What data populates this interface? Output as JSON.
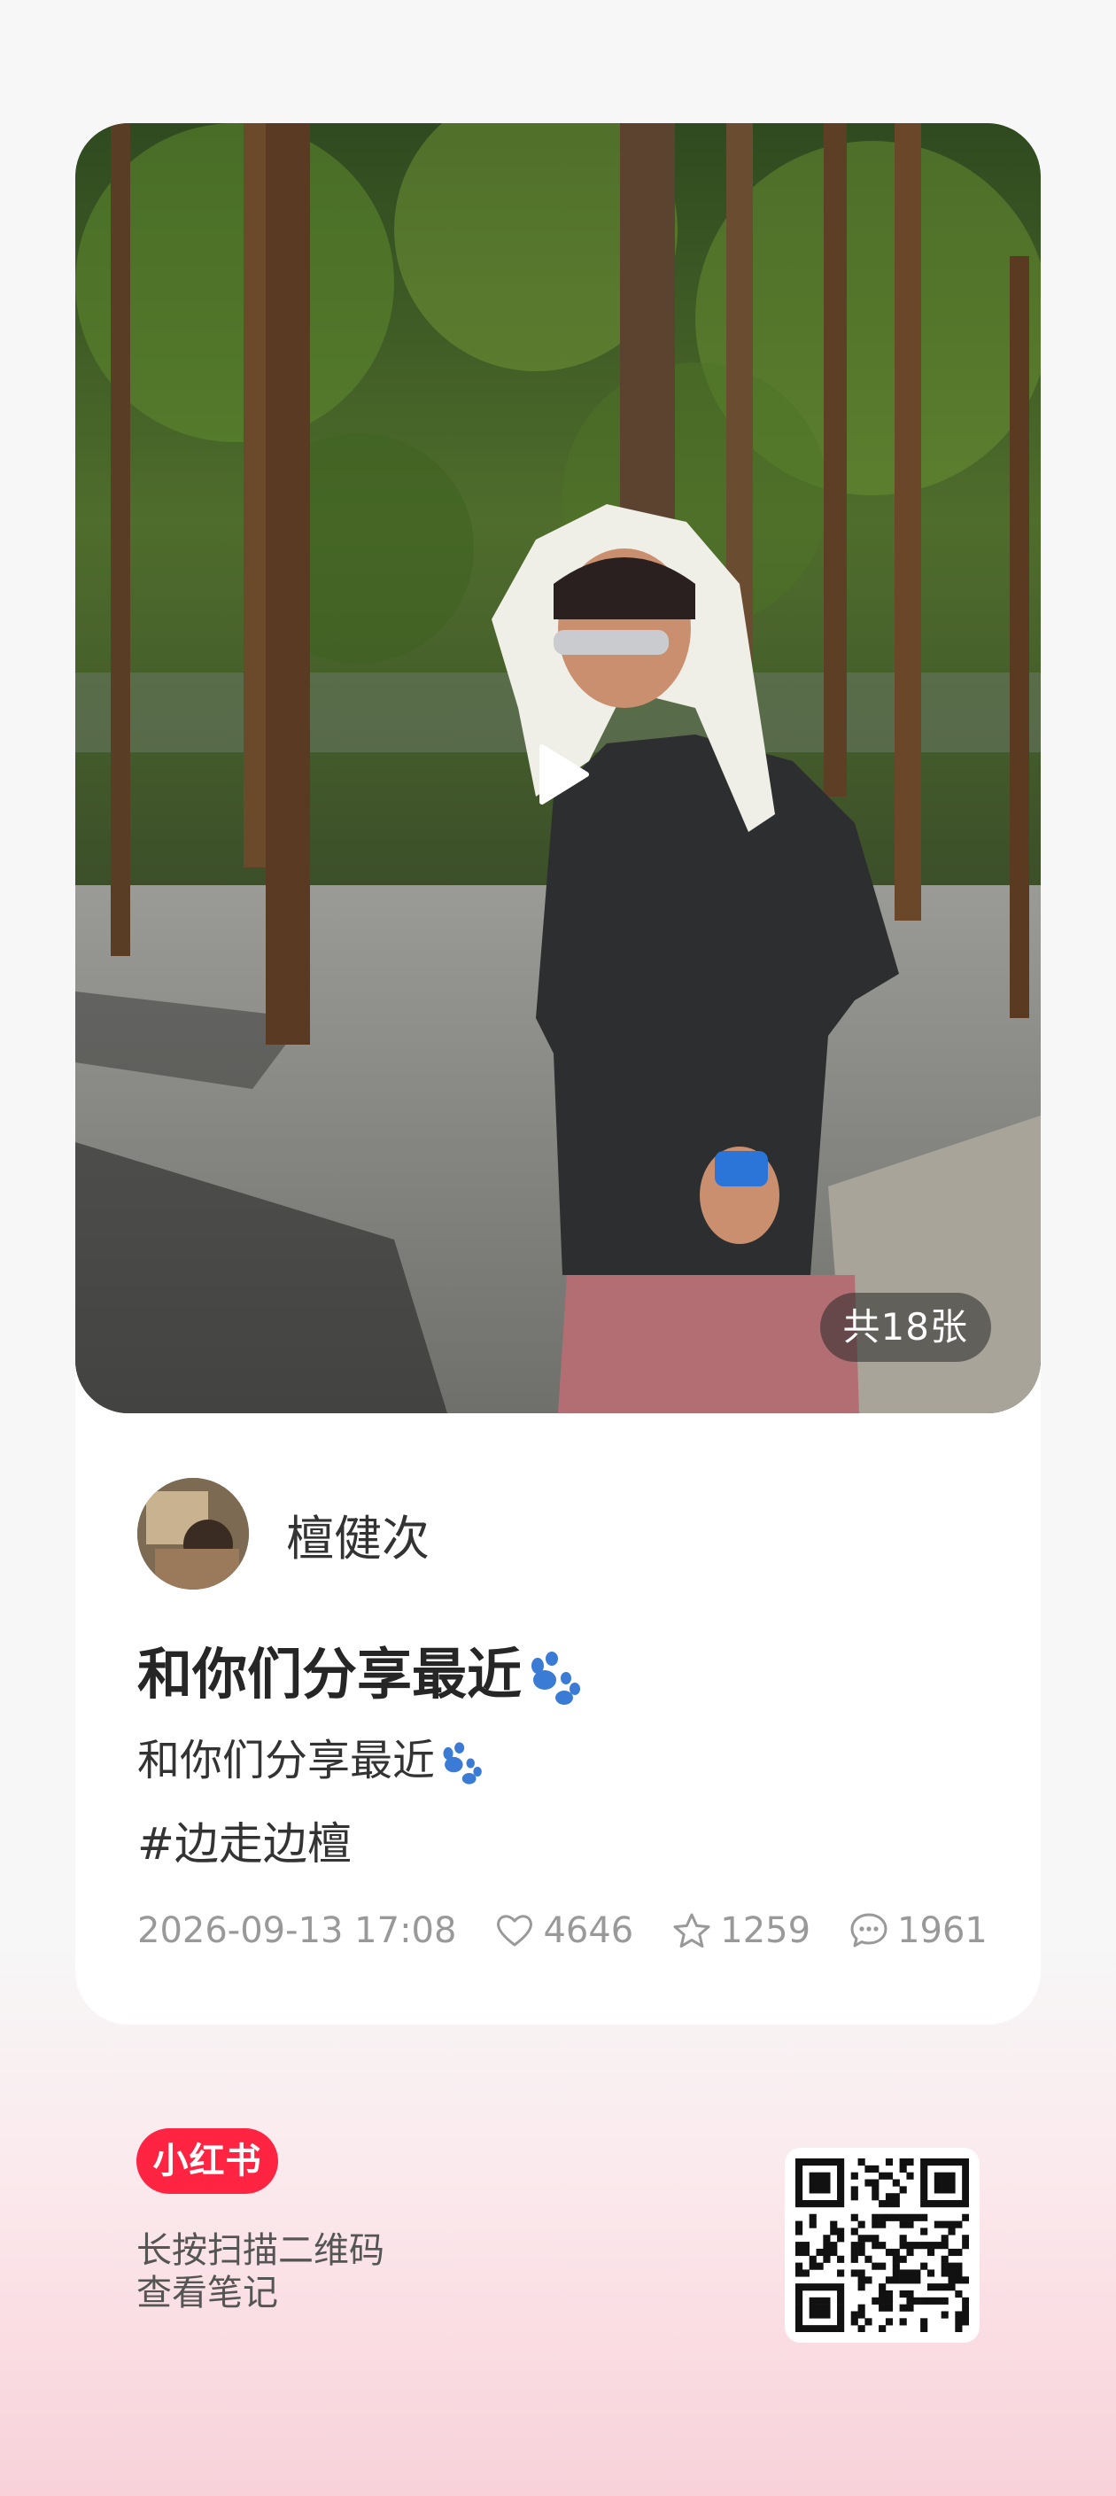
{
  "post": {
    "image_count_label": "共18张",
    "author_name": "檀健次",
    "title": "和你们分享最近",
    "body": "和你们分享最近",
    "hashtag": "#边走边檀",
    "date": "2026-09-13 17:08",
    "likes": "4646",
    "favorites": "1259",
    "comments": "1961"
  },
  "footer": {
    "brand": "小红书",
    "scan_tip_line1": "长按扫描二维码",
    "scan_tip_line2": "查看笔记"
  },
  "colors": {
    "brand_red": "#ff2442",
    "paw_blue": "#3a7bd5",
    "meta_gray": "#999999"
  },
  "icons": [
    "play-icon",
    "paw-icon",
    "heart-icon",
    "star-icon",
    "comment-icon",
    "qr-code"
  ]
}
